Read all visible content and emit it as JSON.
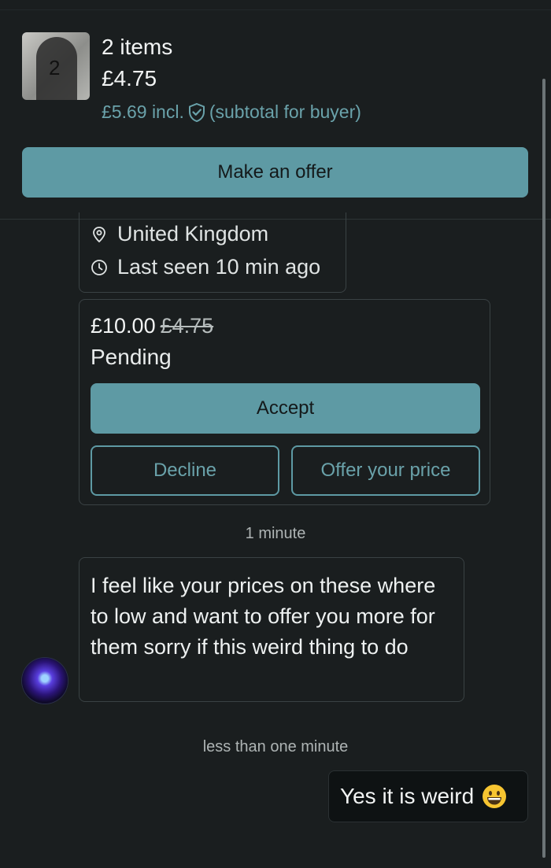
{
  "listing": {
    "thumbnail_count": "2",
    "items_label": "2 items",
    "price": "£4.75",
    "incl_price": "£5.69 incl.",
    "subtotal_note": "(subtotal for buyer)",
    "make_offer_label": "Make an offer"
  },
  "profile": {
    "location": "United Kingdom",
    "last_seen": "Last seen 10 min ago"
  },
  "offer": {
    "new_price": "£10.00",
    "old_price": "£4.75",
    "status": "Pending",
    "accept_label": "Accept",
    "decline_label": "Decline",
    "counter_label": "Offer your price"
  },
  "messages": [
    {
      "time": "1 minute",
      "text": "I feel like your prices on these where to low and want to offer you more for them  sorry if this weird thing to do"
    },
    {
      "time": "less than one minute",
      "text": "Yes it is weird",
      "emoji": "grinning-face-emoji"
    }
  ],
  "colors": {
    "background": "#1a1e1f",
    "accent": "#5e9aa4",
    "accent_text": "#6aa2aa",
    "border": "#3a4244"
  }
}
